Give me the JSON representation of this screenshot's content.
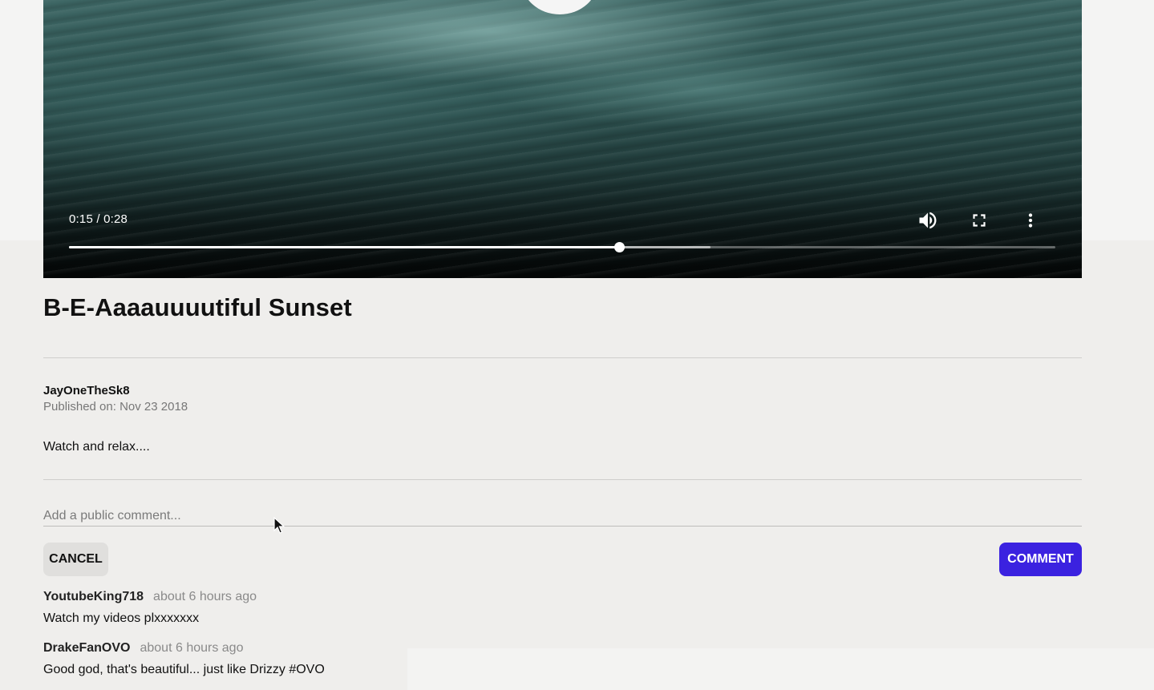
{
  "video": {
    "current_time": "0:15",
    "duration": "0:28",
    "time_display": "0:15 / 0:28",
    "progress_fraction": 0.558,
    "buffered_fraction": 0.65,
    "controls": {
      "volume_icon": "volume-up-icon",
      "fullscreen_icon": "fullscreen-icon",
      "more_icon": "more-vertical-icon"
    }
  },
  "title": "B-E-Aaaauuuutiful Sunset",
  "author": "JayOneTheSk8",
  "published": "Published on: Nov 23 2018",
  "description": "Watch and relax....",
  "comment_form": {
    "placeholder": "Add a public comment...",
    "value": "",
    "cancel_label": "CANCEL",
    "submit_label": "COMMENT"
  },
  "comments": [
    {
      "author": "YoutubeKing718",
      "time": "about 6 hours ago",
      "text": "Watch my videos plxxxxxxx"
    },
    {
      "author": "DrakeFanOVO",
      "time": "about 6 hours ago",
      "text": "Good god, that's beautiful... just like Drizzy #OVO"
    }
  ],
  "colors": {
    "accent": "#3b22e0",
    "background": "#efeeec"
  }
}
